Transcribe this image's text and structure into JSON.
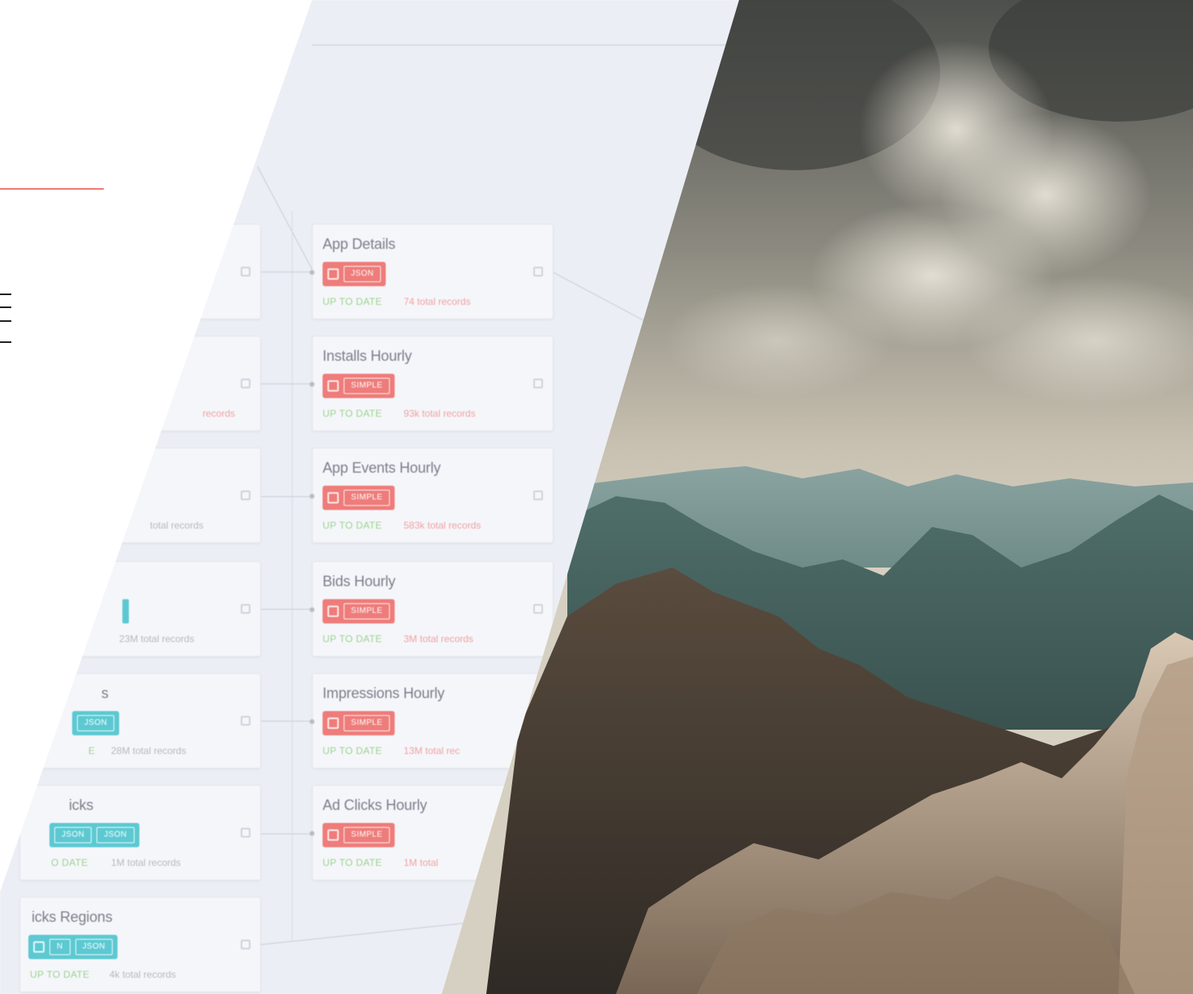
{
  "cards_right": [
    {
      "title": "App Details",
      "chip": "JSON",
      "status": "UP TO DATE",
      "records": "74 total records"
    },
    {
      "title": "Installs Hourly",
      "chip": "SIMPLE",
      "status": "UP TO DATE",
      "records": "93k total records"
    },
    {
      "title": "App Events Hourly",
      "chip": "SIMPLE",
      "status": "UP TO DATE",
      "records": "583k total records"
    },
    {
      "title": "Bids Hourly",
      "chip": "SIMPLE",
      "status": "UP TO DATE",
      "records": "3M total records"
    },
    {
      "title": "Impressions Hourly",
      "chip": "SIMPLE",
      "status": "UP TO DATE",
      "records": "13M total rec"
    },
    {
      "title": "Ad Clicks Hourly",
      "chip": "SIMPLE",
      "status": "UP TO DATE",
      "records": "1M total"
    }
  ],
  "cards_left": [
    {
      "title": "",
      "records": ""
    },
    {
      "title": "",
      "records": "records"
    },
    {
      "title": "",
      "records": "total records"
    },
    {
      "title": "",
      "records": "23M total records"
    },
    {
      "title": "s",
      "chip": "JSON",
      "status": "E",
      "records": "28M total records"
    },
    {
      "title": "icks",
      "chip": "JSON",
      "chip2": "JSON",
      "status": "O DATE",
      "records": "1M total records"
    },
    {
      "title": "icks Regions",
      "chip": "N",
      "chip2": "JSON",
      "status": "UP TO DATE",
      "records": "4k total records"
    }
  ],
  "colors": {
    "accent_red": "#ee7c7a",
    "accent_teal": "#5cc9d2",
    "status_green": "#9bd38f",
    "panel_bg": "#eceef5"
  },
  "icons": [
    "table-icon",
    "drag-handle-icon"
  ]
}
